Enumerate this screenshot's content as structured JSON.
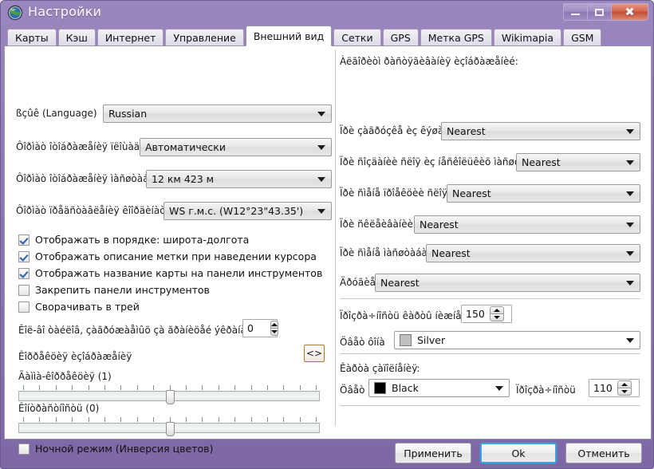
{
  "window": {
    "title": "Настройки",
    "icon": "globe-icon",
    "controls": {
      "minimize": "minimize-icon",
      "maximize": "maximize-icon",
      "close": "close-icon"
    },
    "titlebar_color": "#8b77b1"
  },
  "tabs": [
    {
      "label": "Карты",
      "active": false
    },
    {
      "label": "Кэш",
      "active": false
    },
    {
      "label": "Интернет",
      "active": false
    },
    {
      "label": "Управление",
      "active": false
    },
    {
      "label": "Внешний вид",
      "active": true
    },
    {
      "label": "Сетки",
      "active": false
    },
    {
      "label": "GPS",
      "active": false
    },
    {
      "label": "Метка GPS",
      "active": false
    },
    {
      "label": "Wikimapia",
      "active": false
    },
    {
      "label": "GSM",
      "active": false
    }
  ],
  "left_pane": {
    "combos": [
      {
        "label": "ßçûê (Language)",
        "value": "Russian"
      },
      {
        "label": "Ôîðìàò îòîáðàæåíèÿ ïëîùàäè",
        "value": "Автоматически"
      },
      {
        "label": "Ôîðìàò îòîáðàæåíèÿ ìàñøòàáà",
        "value": "12 км 423 м"
      },
      {
        "label": "Ôîðìàò ïðåäñòàâëåíèÿ êîîðäèíàò",
        "value": "WS г.м.с. (W12°23\"43.35')"
      }
    ],
    "checkboxes": [
      {
        "label": "Отображать в порядке: широта-долгота",
        "checked": true
      },
      {
        "label": "Отображать описание метки при наведении курсора",
        "checked": true
      },
      {
        "label": "Отображать название карты на панели инструментов",
        "checked": true
      },
      {
        "label": "Закрепить панели инструментов",
        "checked": false
      },
      {
        "label": "Сворачивать в трей",
        "checked": false
      }
    ],
    "spinner": {
      "label": "Êîë-âî òàéëîâ, çàãðóæàåìûõ çà ãðàíèöåé ýêðàíà",
      "value": "0"
    },
    "correction_title": "Êîððåêöèÿ èçîáðàæåíèÿ",
    "code_button": "<>",
    "sliders": [
      {
        "label": "Ãàììà-êîððåêöèÿ (1)",
        "value": 1,
        "position_pct": 50
      },
      {
        "label": "Êîíòðàñòíîñòü (0)",
        "value": 0,
        "position_pct": 50
      }
    ],
    "night_mode": {
      "label": "Ночной режим (Инверсия цветов)",
      "checked": false
    }
  },
  "right_pane": {
    "heading": "Àëãîðèòì ðàñòÿãèâàíèÿ èçîáðàæåíèé:",
    "combos": [
      {
        "label": "Ïðè çàãðóçêå èç êýøà",
        "value": "Nearest"
      },
      {
        "label": "Ïðè ñîçäàíèè  ñëîÿ èç íåñêîëüêèõ ìàñøòàáîâ",
        "value": "Nearest"
      },
      {
        "label": "Ïðè ñìåíå ïðîåêöèè ñëîÿ",
        "value": "Nearest"
      },
      {
        "label": "Ïðè ñêëåèâàíèè",
        "value": "Nearest"
      },
      {
        "label": "Ïðè ñìåíå ìàñøòàáà",
        "value": "Nearest"
      },
      {
        "label": "Äðóãèå",
        "value": "Nearest"
      }
    ],
    "transparency": {
      "label": "Ïðîçðà÷íîñòü êàðòû íèæíåãî",
      "value": "150"
    },
    "background": {
      "label": "Öâåò ôîíà",
      "value": "Silver",
      "color": "#c0c0c0"
    },
    "fill_section": {
      "title": "Êàðòà çàïîëíåíèÿ:",
      "color_label": "Öâåò",
      "color_value": "Black",
      "color": "#000000",
      "alpha_label": "Ïðîçðà÷íîñòü",
      "alpha_value": "110"
    }
  },
  "buttons": {
    "apply": "Применить",
    "ok": "Ok",
    "cancel": "Отменить"
  }
}
